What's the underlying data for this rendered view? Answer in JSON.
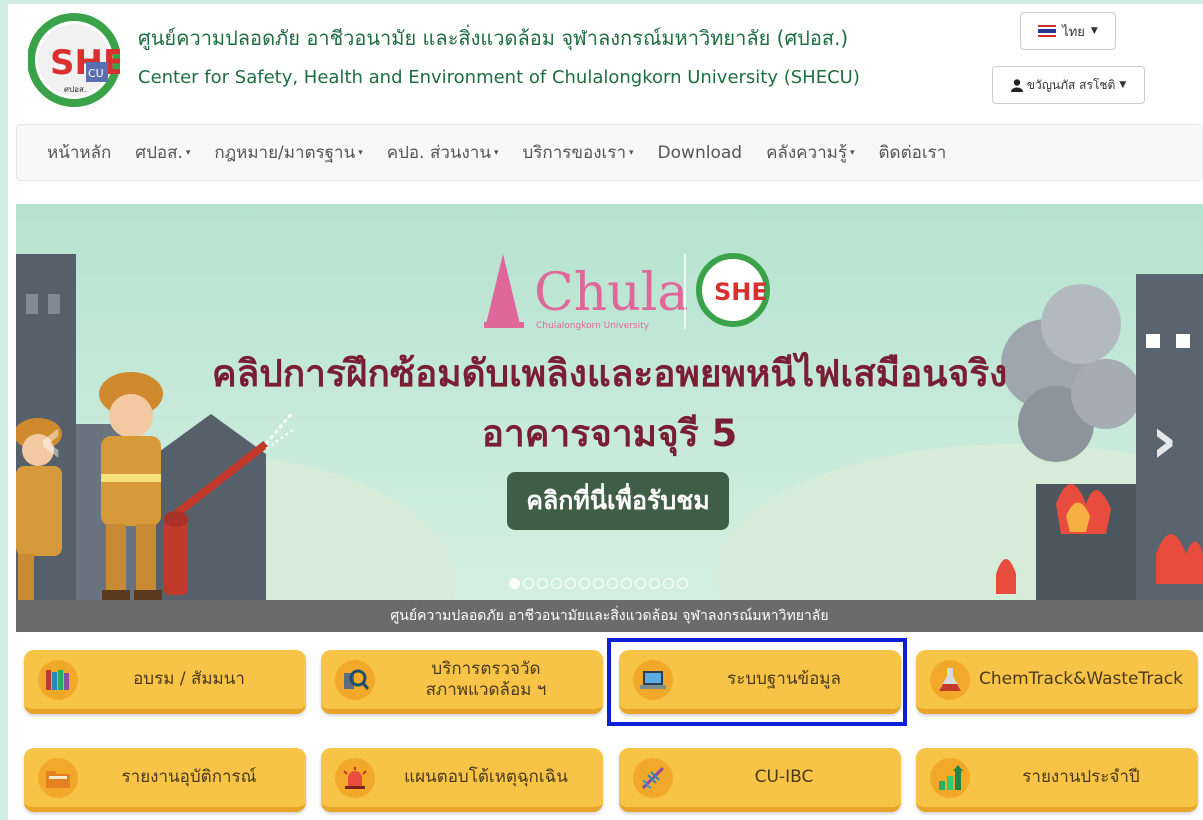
{
  "header": {
    "title_th": "ศูนย์ความปลอดภัย อาชีวอนามัย และสิ่งแวดล้อม จุฬาลงกรณ์มหาวิทยาลัย (ศปอส.)",
    "title_en": "Center for Safety, Health and Environment of Chulalongkorn University (SHECU)",
    "logo_text": "SHE",
    "logo_sub": "CU",
    "logo_small": "ศปอส.",
    "language_label": "ไทย",
    "user_label": "ขวัญนภัส สรโชติ"
  },
  "nav": {
    "items": [
      {
        "label": "หน้าหลัก",
        "dropdown": false
      },
      {
        "label": "ศปอส.",
        "dropdown": true
      },
      {
        "label": "กฎหมาย/มาตรฐาน",
        "dropdown": true
      },
      {
        "label": "คปอ. ส่วนงาน",
        "dropdown": true
      },
      {
        "label": "บริการของเรา",
        "dropdown": true
      },
      {
        "label": "Download",
        "dropdown": false
      },
      {
        "label": "คลังความรู้",
        "dropdown": true
      },
      {
        "label": "ติดต่อเรา",
        "dropdown": false
      }
    ]
  },
  "banner": {
    "brand": "Chula",
    "brand_sub": "Chulalongkorn University",
    "headline_1": "คลิปการฝึกซ้อมดับเพลิงและอพยพหนีไฟเสมือนจริง",
    "headline_2": "อาคารจามจุรี 5",
    "cta_label": "คลิกที่นี่เพื่อรับชม",
    "caption": "ศูนย์ความปลอดภัย อาชีวอนามัยและสิ่งแวดล้อม จุฬาลงกรณ์มหาวิทยาลัย",
    "slide_count": 13,
    "active_slide": 1,
    "prev_arrow": "‹",
    "next_arrow": "›"
  },
  "tiles": {
    "training": "อบรม / สัมมนา",
    "inspection_1": "บริการตรวจวัด",
    "inspection_2": "สภาพแวดล้อม ฯ",
    "database": "ระบบฐานข้อมูล",
    "chemtrack": "ChemTrack&WasteTrack",
    "accident": "รายงานอุบัติการณ์",
    "emergency": "แผนตอบโต้เหตุฉุกเฉิน",
    "cuibc": "CU-IBC",
    "annual": "รายงานประจำปี"
  },
  "colors": {
    "brand_green": "#1f6d43",
    "tile_yellow": "#f7c447",
    "highlight_blue": "#0a1fd6",
    "headline_maroon": "#7a1f33",
    "cta_green": "#3f5e45"
  }
}
